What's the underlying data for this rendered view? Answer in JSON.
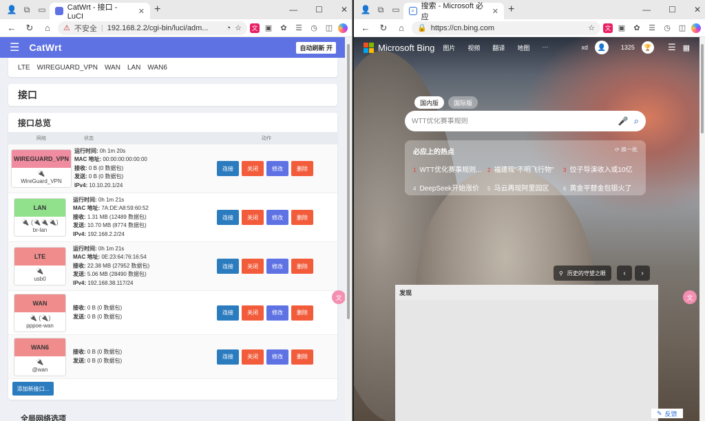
{
  "left": {
    "tab_title": "CatWrt - 接口 - LuCI",
    "url_warning": "不安全",
    "url": "192.168.2.2/cgi-bin/luci/adm...",
    "brand": "CatWrt",
    "auto_refresh": "自动刷新 开",
    "subnav": [
      "LTE",
      "WIREGUARD_VPN",
      "WAN",
      "LAN",
      "WAN6"
    ],
    "page_title": "接口",
    "section_title": "接口总览",
    "columns": {
      "network": "网络",
      "status": "状态",
      "actions": "动作"
    },
    "buttons": {
      "connect": "连接",
      "close": "关闭",
      "edit": "修改",
      "delete": "删除"
    },
    "interfaces": [
      {
        "name": "WIREGUARD_VPN",
        "color": "#f08ca0",
        "device": "WireGuard_VPN",
        "dev_icons": "🔌",
        "uptime_label": "运行时间:",
        "uptime": "0h 1m 20s",
        "mac_label": "MAC 地址:",
        "mac": "00:00:00:00:00:00",
        "rx_label": "接收:",
        "rx": "0 B (0 数据包)",
        "tx_label": "发送:",
        "tx": "0 B (0 数据包)",
        "ip_label": "IPv4:",
        "ip": "10.10.20.1/24"
      },
      {
        "name": "LAN",
        "color": "#90e08c",
        "device": "br-lan",
        "dev_icons": "🔌 (🔌🔌🔌)",
        "uptime_label": "运行时间:",
        "uptime": "0h 1m 21s",
        "mac_label": "MAC 地址:",
        "mac": "7A:DE:A8:59:60:52",
        "rx_label": "接收:",
        "rx": "1.31 MB (12489 数据包)",
        "tx_label": "发送:",
        "tx": "10.70 MB (8774 数据包)",
        "ip_label": "IPv4:",
        "ip": "192.168.2.2/24"
      },
      {
        "name": "LTE",
        "color": "#f08c8c",
        "device": "usb0",
        "dev_icons": "🔌",
        "uptime_label": "运行时间:",
        "uptime": "0h 1m 21s",
        "mac_label": "MAC 地址:",
        "mac": "0E:23:64:76:16:54",
        "rx_label": "接收:",
        "rx": "22.38 MB (27952 数据包)",
        "tx_label": "发送:",
        "tx": "5.06 MB (28490 数据包)",
        "ip_label": "IPv4:",
        "ip": "192.168.38.117/24"
      },
      {
        "name": "WAN",
        "color": "#f08c8c",
        "device": "pppoe-wan",
        "dev_icons": "🔌 (🔌)",
        "rx_label": "接收:",
        "rx": "0 B (0 数据包)",
        "tx_label": "发送:",
        "tx": "0 B (0 数据包)"
      },
      {
        "name": "WAN6",
        "color": "#f08c8c",
        "device": "@wan",
        "dev_icons": "🔌",
        "rx_label": "接收:",
        "rx": "0 B (0 数据包)",
        "tx_label": "发送:",
        "tx": "0 B (0 数据包)"
      }
    ],
    "add_interface": "添加新接口...",
    "global_options": "全局网络选项"
  },
  "right": {
    "tab_title": "搜索 - Microsoft 必应",
    "url": "https://cn.bing.com",
    "brand": "Microsoft Bing",
    "nav": [
      "图片",
      "视频",
      "翻译",
      "地图",
      "···"
    ],
    "user": "xd",
    "points": "1325",
    "version_tabs": [
      "国内版",
      "国际版"
    ],
    "search_placeholder": "WTT优化赛事规则",
    "hot_title": "必应上的热点",
    "hot_refresh": "换一批",
    "hot_items": [
      {
        "n": "1",
        "text": "WTT优化赛事规则..."
      },
      {
        "n": "2",
        "text": "福建现\"不明飞行物\""
      },
      {
        "n": "3",
        "text": "饺子导演收入或10亿"
      },
      {
        "n": "4",
        "text": "DeepSeek开始涨价"
      },
      {
        "n": "5",
        "text": "马云再现阿里园区"
      },
      {
        "n": "6",
        "text": "黄金平替金包银火了"
      }
    ],
    "location": "历史的守望之眼",
    "discover": "发现",
    "feedback": "反馈"
  }
}
